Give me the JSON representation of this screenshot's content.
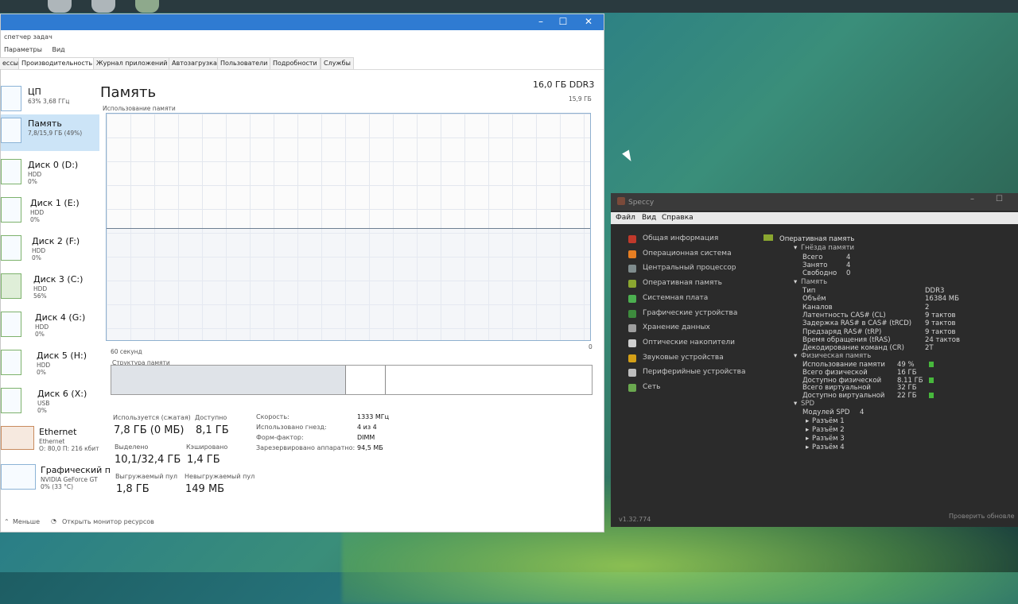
{
  "taskmgr": {
    "title_caption": "спетчер задач",
    "menu": [
      "Параметры",
      "Вид"
    ],
    "tabs": [
      "ессы",
      "Производительность",
      "Журнал приложений",
      "Автозагрузка",
      "Пользователи",
      "Подробности",
      "Службы"
    ],
    "active_tab_index": 1,
    "sidebar": [
      {
        "name": "ЦП",
        "l1": "63% 3,68 ГГц",
        "l2": ""
      },
      {
        "name": "Память",
        "l1": "7,8/15,9 ГБ (49%)",
        "l2": ""
      },
      {
        "name": "Диск 0 (D:)",
        "l1": "HDD",
        "l2": "0%"
      },
      {
        "name": "Диск 1 (E:)",
        "l1": "HDD",
        "l2": "0%"
      },
      {
        "name": "Диск 2 (F:)",
        "l1": "HDD",
        "l2": "0%"
      },
      {
        "name": "Диск 3 (C:)",
        "l1": "HDD",
        "l2": "56%"
      },
      {
        "name": "Диск 4 (G:)",
        "l1": "HDD",
        "l2": "0%"
      },
      {
        "name": "Диск 5 (H:)",
        "l1": "HDD",
        "l2": "0%"
      },
      {
        "name": "Диск 6 (X:)",
        "l1": "USB",
        "l2": "0%"
      },
      {
        "name": "Ethernet",
        "l1": "Ethernet",
        "l2": "О: 80,0 П: 216 кбит"
      },
      {
        "name": "Графический п",
        "l1": "NVIDIA GeForce GT",
        "l2": "0% (33 °C)"
      }
    ],
    "main_title": "Память",
    "spec": "16,0 ГБ DDR3",
    "graph_label": "Использование памяти",
    "graph_max": "15,9 ГБ",
    "graph_time": "60 секунд",
    "graph_zero": "0",
    "usage_fraction": 0.49,
    "struct_label": "Структура памяти",
    "stats": {
      "used_lbl": "Используется (сжатая)",
      "used_val": "7,8 ГБ (0 МБ)",
      "avail_lbl": "Доступно",
      "avail_val": "8,1 ГБ",
      "commit_lbl": "Выделено",
      "commit_val": "10,1/32,4 ГБ",
      "cached_lbl": "Кэшировано",
      "cached_val": "1,4 ГБ",
      "paged_lbl": "Выгружаемый пул",
      "paged_val": "1,8 ГБ",
      "nonpaged_lbl": "Невыгружаемый пул",
      "nonpaged_val": "149 МБ"
    },
    "kv": [
      {
        "k": "Скорость:",
        "v": "1333 МГц"
      },
      {
        "k": "Использовано гнезд:",
        "v": "4 из 4"
      },
      {
        "k": "Форм-фактор:",
        "v": "DIMM"
      },
      {
        "k": "Зарезервировано аппаратно:",
        "v": "94,5 МБ"
      }
    ],
    "footer_less": "Меньше",
    "footer_monitor": "Открыть монитор ресурсов"
  },
  "speccy": {
    "title": "Speccy",
    "menu": [
      "Файл",
      "Вид",
      "Справка"
    ],
    "nav": [
      {
        "label": "Общая информация",
        "color": "#c0392b"
      },
      {
        "label": "Операционная система",
        "color": "#e67e22"
      },
      {
        "label": "Центральный процессор",
        "color": "#7f8c8d"
      },
      {
        "label": "Оперативная память",
        "color": "#8aa630"
      },
      {
        "label": "Системная плата",
        "color": "#4caf50"
      },
      {
        "label": "Графические устройства",
        "color": "#3d8b3d"
      },
      {
        "label": "Хранение данных",
        "color": "#9e9e9e"
      },
      {
        "label": "Оптические накопители",
        "color": "#cfcfcf"
      },
      {
        "label": "Звуковые устройства",
        "color": "#d4a017"
      },
      {
        "label": "Периферийные устройства",
        "color": "#bdbdbd"
      },
      {
        "label": "Сеть",
        "color": "#6aa84f"
      }
    ],
    "section_title": "Оперативная память",
    "slots_hdr": "Гнёзда памяти",
    "slots": [
      {
        "k": "Всего",
        "v": "4"
      },
      {
        "k": "Занято",
        "v": "4"
      },
      {
        "k": "Свободно",
        "v": "0"
      }
    ],
    "mem_hdr": "Память",
    "mem": [
      {
        "k": "Тип",
        "v": "DDR3"
      },
      {
        "k": "Объём",
        "v": "16384 МБ"
      },
      {
        "k": "Каналов",
        "v": "2"
      },
      {
        "k": "Латентность CAS# (CL)",
        "v": "9 тактов"
      },
      {
        "k": "Задержка RAS# в CAS# (tRCD)",
        "v": "9 тактов"
      },
      {
        "k": "Предзаряд RAS# (tRP)",
        "v": "9 тактов"
      },
      {
        "k": "Время обращения (tRAS)",
        "v": "24 тактов"
      },
      {
        "k": "Декодирование команд (CR)",
        "v": "2T"
      }
    ],
    "phys_hdr": "Физическая память",
    "phys": [
      {
        "k": "Использование памяти",
        "v": "49 %"
      },
      {
        "k": "Всего физической",
        "v": "16 ГБ"
      },
      {
        "k": "Доступно физической",
        "v": "8.11 ГБ"
      },
      {
        "k": "Всего виртуальной",
        "v": "32 ГБ"
      },
      {
        "k": "Доступно виртуальной",
        "v": "22 ГБ"
      }
    ],
    "spd_hdr": "SPD",
    "spd_count_lbl": "Модулей SPD",
    "spd_count": "4",
    "spd_slots": [
      "Разъём 1",
      "Разъём 2",
      "Разъём 3",
      "Разъём 4"
    ],
    "version": "v1.32.774",
    "update_check": "Проверить обновле"
  }
}
